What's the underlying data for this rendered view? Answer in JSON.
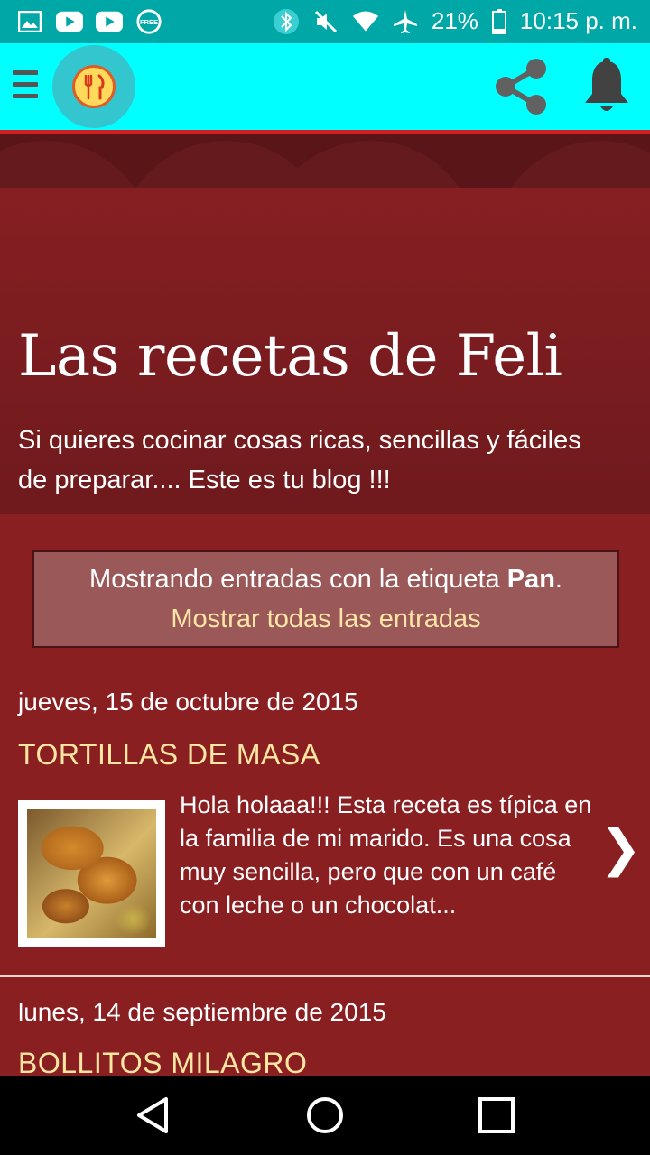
{
  "status_bar": {
    "battery": "21%",
    "time": "10:15 p. m.",
    "free_badge": "FREE"
  },
  "toolbar": {
    "menu_icon": "hamburger-icon",
    "logo_icon": "fork-knife-icon",
    "share_icon": "share-icon",
    "notifications_icon": "bell-icon",
    "colors": {
      "toolbar": "#00ffff",
      "status": "#00a7a7",
      "accent_line": "#d11f24"
    }
  },
  "blog": {
    "title": "Las recetas de Feli",
    "description": "Si quieres cocinar cosas ricas, sencillas y fáciles de preparar.... Este es tu blog !!!"
  },
  "label_notice": {
    "prefix": "Mostrando entradas con la etiqueta ",
    "label": "Pan",
    "suffix": ".",
    "show_all": "Mostrar todas las entradas"
  },
  "posts": [
    {
      "date": "jueves, 15 de octubre de 2015",
      "title": "TORTILLAS DE MASA",
      "snippet": "Hola holaaa!!! Esta receta es típica en la familia de mi marido. Es una cosa muy sencilla, pero que con un café con leche o un chocolat...",
      "arrow": "❯"
    },
    {
      "date": "lunes, 14 de septiembre de 2015",
      "title": "BOLLITOS MILAGRO"
    }
  ],
  "nav_bar": {
    "back_icon": "back-triangle-icon",
    "home_icon": "home-circle-icon",
    "recents_icon": "recents-square-icon"
  }
}
